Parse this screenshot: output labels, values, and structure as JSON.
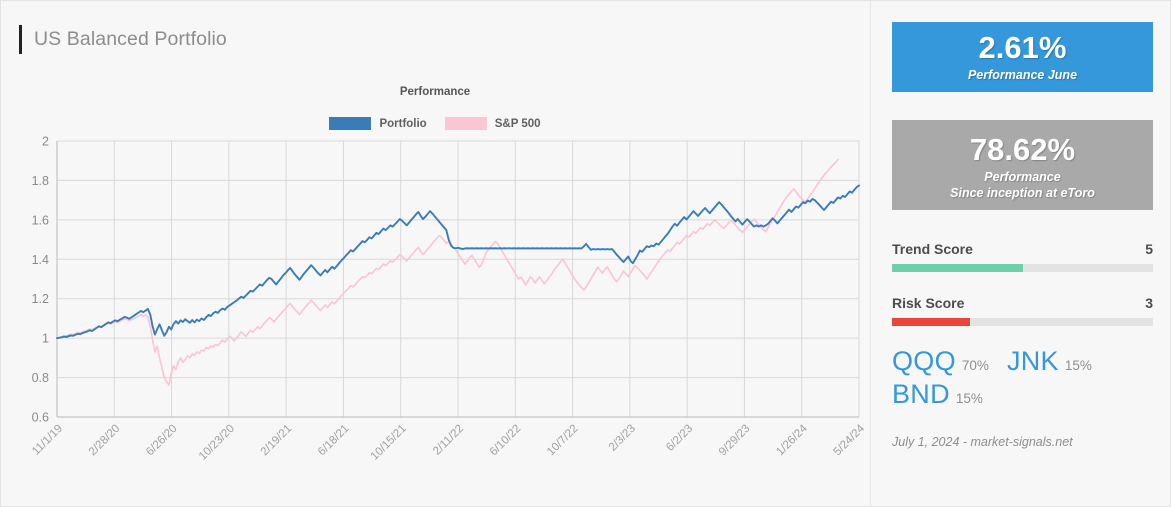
{
  "header": {
    "title": "US Balanced Portfolio",
    "accent_color": "#222222"
  },
  "chart_panel": {
    "title": "Performance",
    "legend": [
      {
        "label": "Portfolio",
        "color": "#3a7cb8",
        "icon": "legend-swatch"
      },
      {
        "label": "S&P 500",
        "color": "#fbc6d4",
        "icon": "legend-swatch"
      }
    ]
  },
  "chart_data": {
    "type": "line",
    "title": "Performance",
    "xlabel": "",
    "ylabel": "",
    "ylim": [
      0.6,
      2.0
    ],
    "y_ticks": [
      "0.6",
      "0.8",
      "1",
      "1.2",
      "1.4",
      "1.6",
      "1.8",
      "2"
    ],
    "y_tick_values": [
      0.6,
      0.8,
      1.0,
      1.2,
      1.4,
      1.6,
      1.8,
      2.0
    ],
    "grid": true,
    "legend_position": "top-center",
    "x_ticks": [
      "11/1/19",
      "2/28/20",
      "6/26/20",
      "10/23/20",
      "2/19/21",
      "6/18/21",
      "10/15/21",
      "2/11/22",
      "6/10/22",
      "10/7/22",
      "2/3/23",
      "6/2/23",
      "9/29/23",
      "1/26/24",
      "5/24/24"
    ],
    "series": [
      {
        "name": "Portfolio",
        "color": "#3a7cb8",
        "values": [
          1.0,
          1.002,
          1.004,
          1.008,
          1.006,
          1.01,
          1.014,
          1.012,
          1.018,
          1.022,
          1.02,
          1.026,
          1.03,
          1.034,
          1.04,
          1.036,
          1.044,
          1.052,
          1.06,
          1.056,
          1.064,
          1.072,
          1.08,
          1.076,
          1.084,
          1.09,
          1.086,
          1.094,
          1.1,
          1.108,
          1.104,
          1.098,
          1.106,
          1.114,
          1.122,
          1.13,
          1.138,
          1.132,
          1.14,
          1.148,
          1.12,
          1.06,
          1.018,
          1.046,
          1.07,
          1.04,
          1.012,
          1.03,
          1.058,
          1.044,
          1.072,
          1.086,
          1.074,
          1.09,
          1.082,
          1.096,
          1.086,
          1.078,
          1.092,
          1.08,
          1.094,
          1.086,
          1.1,
          1.092,
          1.106,
          1.118,
          1.112,
          1.126,
          1.134,
          1.128,
          1.142,
          1.15,
          1.144,
          1.158,
          1.166,
          1.174,
          1.182,
          1.19,
          1.2,
          1.21,
          1.204,
          1.216,
          1.228,
          1.24,
          1.236,
          1.248,
          1.26,
          1.272,
          1.266,
          1.28,
          1.294,
          1.306,
          1.3,
          1.286,
          1.272,
          1.288,
          1.302,
          1.318,
          1.33,
          1.344,
          1.356,
          1.34,
          1.324,
          1.31,
          1.296,
          1.312,
          1.328,
          1.342,
          1.356,
          1.37,
          1.358,
          1.344,
          1.33,
          1.318,
          1.332,
          1.346,
          1.334,
          1.348,
          1.362,
          1.352,
          1.366,
          1.38,
          1.394,
          1.406,
          1.42,
          1.432,
          1.446,
          1.44,
          1.452,
          1.466,
          1.478,
          1.492,
          1.486,
          1.498,
          1.512,
          1.506,
          1.52,
          1.534,
          1.528,
          1.542,
          1.556,
          1.548,
          1.56,
          1.572,
          1.566,
          1.578,
          1.59,
          1.604,
          1.596,
          1.584,
          1.572,
          1.586,
          1.6,
          1.614,
          1.628,
          1.64,
          1.62,
          1.604,
          1.616,
          1.63,
          1.644,
          1.632,
          1.618,
          1.604,
          1.59,
          1.576,
          1.562,
          1.548,
          1.5,
          1.47,
          1.458,
          1.456,
          1.458,
          1.455,
          1.452,
          1.455,
          1.456,
          1.455,
          1.456,
          1.455,
          1.456,
          1.455,
          1.456,
          1.455,
          1.456,
          1.455,
          1.456,
          1.455,
          1.456,
          1.455,
          1.456,
          1.455,
          1.456,
          1.455,
          1.456,
          1.455,
          1.456,
          1.455,
          1.456,
          1.455,
          1.456,
          1.455,
          1.456,
          1.455,
          1.456,
          1.455,
          1.456,
          1.455,
          1.456,
          1.455,
          1.456,
          1.455,
          1.456,
          1.455,
          1.456,
          1.455,
          1.456,
          1.455,
          1.456,
          1.455,
          1.456,
          1.455,
          1.456,
          1.455,
          1.456,
          1.455,
          1.466,
          1.478,
          1.462,
          1.448,
          1.452,
          1.45,
          1.452,
          1.45,
          1.452,
          1.45,
          1.452,
          1.45,
          1.452,
          1.44,
          1.424,
          1.412,
          1.398,
          1.386,
          1.4,
          1.414,
          1.392,
          1.38,
          1.4,
          1.42,
          1.444,
          1.438,
          1.452,
          1.466,
          1.462,
          1.47,
          1.466,
          1.48,
          1.474,
          1.488,
          1.502,
          1.516,
          1.53,
          1.548,
          1.566,
          1.58,
          1.57,
          1.586,
          1.6,
          1.614,
          1.602,
          1.616,
          1.63,
          1.644,
          1.632,
          1.62,
          1.634,
          1.648,
          1.66,
          1.646,
          1.634,
          1.648,
          1.662,
          1.676,
          1.69,
          1.678,
          1.664,
          1.65,
          1.636,
          1.62,
          1.606,
          1.592,
          1.604,
          1.59,
          1.576,
          1.59,
          1.604,
          1.592,
          1.578,
          1.566,
          1.572,
          1.566,
          1.572,
          1.566,
          1.572,
          1.58,
          1.594,
          1.608,
          1.596,
          1.582,
          1.596,
          1.61,
          1.624,
          1.638,
          1.652,
          1.64,
          1.654,
          1.668,
          1.662,
          1.676,
          1.69,
          1.684,
          1.698,
          1.692,
          1.706,
          1.7,
          1.688,
          1.676,
          1.662,
          1.65,
          1.664,
          1.678,
          1.692,
          1.686,
          1.7,
          1.714,
          1.708,
          1.722,
          1.716,
          1.73,
          1.744,
          1.738,
          1.752,
          1.766,
          1.774
        ]
      },
      {
        "name": "S&P 500",
        "color": "#fbc6d4",
        "values": [
          1.0,
          1.004,
          1.008,
          1.012,
          1.01,
          1.016,
          1.02,
          1.018,
          1.024,
          1.028,
          1.026,
          1.032,
          1.036,
          1.04,
          1.046,
          1.042,
          1.048,
          1.054,
          1.06,
          1.058,
          1.064,
          1.07,
          1.076,
          1.072,
          1.078,
          1.084,
          1.08,
          1.086,
          1.092,
          1.098,
          1.094,
          1.088,
          1.094,
          1.1,
          1.106,
          1.112,
          1.118,
          1.112,
          1.118,
          1.108,
          1.06,
          0.99,
          0.93,
          0.96,
          0.9,
          0.85,
          0.8,
          0.78,
          0.762,
          0.82,
          0.86,
          0.84,
          0.88,
          0.9,
          0.878,
          0.89,
          0.91,
          0.9,
          0.92,
          0.912,
          0.93,
          0.922,
          0.94,
          0.934,
          0.952,
          0.946,
          0.96,
          0.954,
          0.968,
          0.962,
          0.976,
          0.99,
          0.98,
          0.996,
          1.01,
          1.0,
          0.986,
          1.0,
          1.016,
          1.032,
          1.02,
          1.01,
          1.024,
          1.04,
          1.03,
          1.044,
          1.058,
          1.048,
          1.062,
          1.076,
          1.09,
          1.104,
          1.096,
          1.082,
          1.096,
          1.11,
          1.124,
          1.138,
          1.15,
          1.164,
          1.176,
          1.16,
          1.146,
          1.134,
          1.12,
          1.136,
          1.15,
          1.164,
          1.178,
          1.192,
          1.18,
          1.166,
          1.152,
          1.14,
          1.154,
          1.168,
          1.156,
          1.17,
          1.184,
          1.174,
          1.188,
          1.202,
          1.216,
          1.228,
          1.24,
          1.252,
          1.266,
          1.26,
          1.272,
          1.286,
          1.298,
          1.312,
          1.306,
          1.318,
          1.332,
          1.326,
          1.34,
          1.354,
          1.348,
          1.362,
          1.376,
          1.368,
          1.38,
          1.392,
          1.386,
          1.398,
          1.41,
          1.424,
          1.416,
          1.404,
          1.392,
          1.406,
          1.42,
          1.434,
          1.448,
          1.46,
          1.44,
          1.424,
          1.438,
          1.452,
          1.466,
          1.48,
          1.494,
          1.508,
          1.52,
          1.51,
          1.496,
          1.48,
          1.49,
          1.478,
          1.46,
          1.448,
          1.43,
          1.412,
          1.394,
          1.376,
          1.39,
          1.408,
          1.42,
          1.4,
          1.38,
          1.36,
          1.37,
          1.4,
          1.432,
          1.448,
          1.462,
          1.476,
          1.49,
          1.48,
          1.46,
          1.44,
          1.42,
          1.4,
          1.38,
          1.36,
          1.34,
          1.32,
          1.3,
          1.31,
          1.29,
          1.27,
          1.29,
          1.312,
          1.3,
          1.28,
          1.296,
          1.31,
          1.292,
          1.276,
          1.29,
          1.308,
          1.322,
          1.34,
          1.358,
          1.372,
          1.388,
          1.4,
          1.38,
          1.36,
          1.34,
          1.32,
          1.3,
          1.285,
          1.27,
          1.256,
          1.244,
          1.26,
          1.28,
          1.3,
          1.32,
          1.34,
          1.36,
          1.344,
          1.33,
          1.348,
          1.362,
          1.34,
          1.32,
          1.3,
          1.286,
          1.3,
          1.32,
          1.34,
          1.326,
          1.312,
          1.33,
          1.35,
          1.368,
          1.356,
          1.344,
          1.33,
          1.316,
          1.3,
          1.318,
          1.336,
          1.354,
          1.372,
          1.39,
          1.406,
          1.42,
          1.434,
          1.448,
          1.44,
          1.456,
          1.47,
          1.486,
          1.478,
          1.492,
          1.506,
          1.52,
          1.512,
          1.526,
          1.54,
          1.532,
          1.546,
          1.56,
          1.552,
          1.566,
          1.58,
          1.572,
          1.586,
          1.6,
          1.59,
          1.578,
          1.566,
          1.556,
          1.57,
          1.584,
          1.598,
          1.588,
          1.574,
          1.56,
          1.548,
          1.536,
          1.55,
          1.564,
          1.578,
          1.592,
          1.604,
          1.59,
          1.576,
          1.562,
          1.55,
          1.54,
          1.56,
          1.58,
          1.6,
          1.62,
          1.64,
          1.66,
          1.68,
          1.7,
          1.716,
          1.73,
          1.744,
          1.758,
          1.742,
          1.726,
          1.712,
          1.7,
          1.69,
          1.706,
          1.722,
          1.74,
          1.758,
          1.776,
          1.794,
          1.812,
          1.826,
          1.84,
          1.854,
          1.868,
          1.88,
          1.892,
          1.906
        ]
      }
    ]
  },
  "stats": {
    "month": {
      "value": "2.61%",
      "caption": "Performance June",
      "color": "#3498db"
    },
    "inception": {
      "value": "78.62%",
      "caption_line1": "Performance",
      "caption_line2": "Since inception at eToro",
      "color": "#a9a9a9"
    }
  },
  "scores": [
    {
      "label": "Trend Score",
      "value": "5",
      "fill_percent": 50,
      "color": "#6ecfab"
    },
    {
      "label": "Risk Score",
      "value": "3",
      "fill_percent": 30,
      "color": "#e8463a"
    }
  ],
  "holdings": [
    {
      "ticker": "QQQ",
      "weight": "70%"
    },
    {
      "ticker": "JNK",
      "weight": "15%"
    },
    {
      "ticker": "BND",
      "weight": "15%"
    }
  ],
  "footnote": "July 1, 2024 - market-signals.net"
}
